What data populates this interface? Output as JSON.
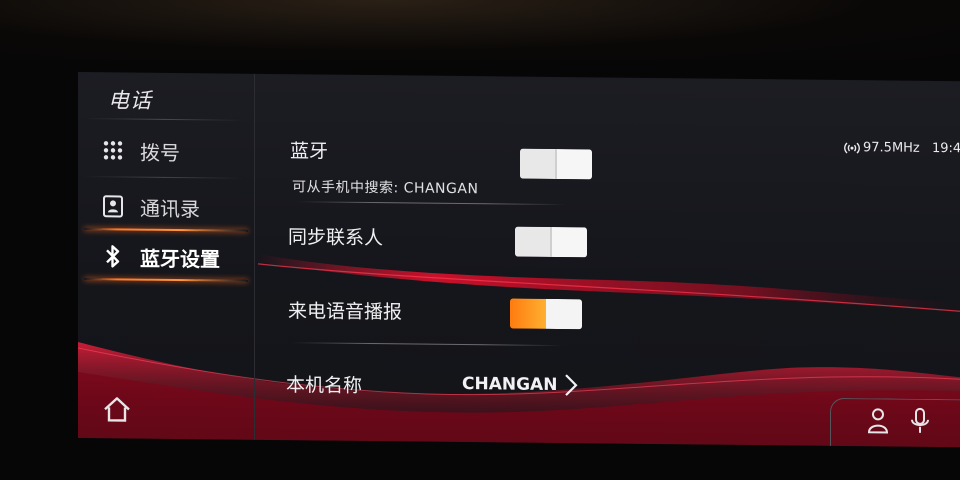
{
  "app": {
    "title": "电话"
  },
  "sidebar": {
    "items": [
      {
        "label": "拨号",
        "icon": "dialpad-icon",
        "active": false
      },
      {
        "label": "通讯录",
        "icon": "contacts-icon",
        "active": false
      },
      {
        "label": "蓝牙设置",
        "icon": "bluetooth-icon",
        "active": true
      }
    ],
    "home_icon": "home-icon"
  },
  "status_bar": {
    "radio": "97.5MHz",
    "time": "19:4"
  },
  "settings": {
    "bluetooth": {
      "label": "蓝牙",
      "subtitle": "可从手机中搜索: CHANGAN",
      "state": "off"
    },
    "sync_contacts": {
      "label": "同步联系人",
      "state": "off"
    },
    "call_announce": {
      "label": "来电语音播报",
      "state": "on"
    },
    "device_name": {
      "label": "本机名称",
      "value": "CHANGAN"
    }
  },
  "corner": {
    "icons": [
      "person-icon",
      "microphone-icon"
    ]
  },
  "colors": {
    "accent": "#ff8a2a",
    "wave": "#e0102a",
    "background": "#16171c"
  }
}
